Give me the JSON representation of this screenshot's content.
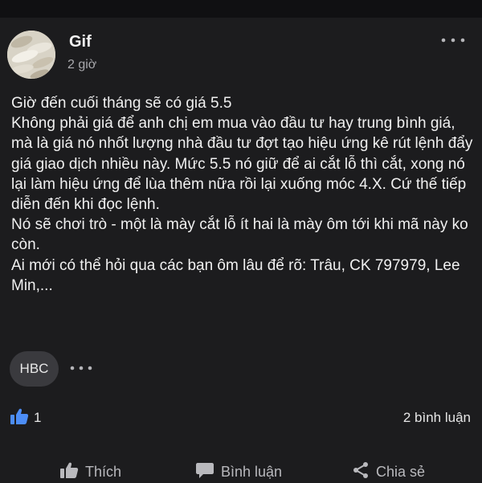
{
  "post": {
    "author": "Gif",
    "time": "2 giờ",
    "body": "Giờ đến cuối tháng sẽ có giá 5.5\nKhông phải giá để anh chị em mua vào đầu tư hay trung bình giá, mà là giá nó nhốt lượng nhà đầu tư đợt tạo hiệu ứng kê rút lệnh đẩy giá giao dịch nhiều này. Mức 5.5 nó giữ để ai cắt lỗ thì cắt, xong nó lại làm hiệu ứng để lùa thêm nữa rồi lại xuống móc 4.X. Cứ thế tiếp diễn đến khi đọc lệnh.\nNó sẽ chơi trò - một là mày cắt lỗ ít hai là mày ôm tới khi mã này ko còn.\nAi mới có thể hỏi qua các bạn ôm lâu để rõ: Trâu, CK 797979, Lee Min,...",
    "tag": "HBC"
  },
  "stats": {
    "likes": "1",
    "comments": "2 bình luận"
  },
  "actions": {
    "like": "Thích",
    "comment": "Bình luận",
    "share": "Chia sẻ"
  },
  "colors": {
    "background": "#1c1c1e",
    "like_blue": "#4c8df6",
    "chip": "#3a3a3e"
  },
  "icons": [
    "more-options-icon",
    "thumbs-up-icon",
    "comment-icon",
    "share-icon"
  ]
}
